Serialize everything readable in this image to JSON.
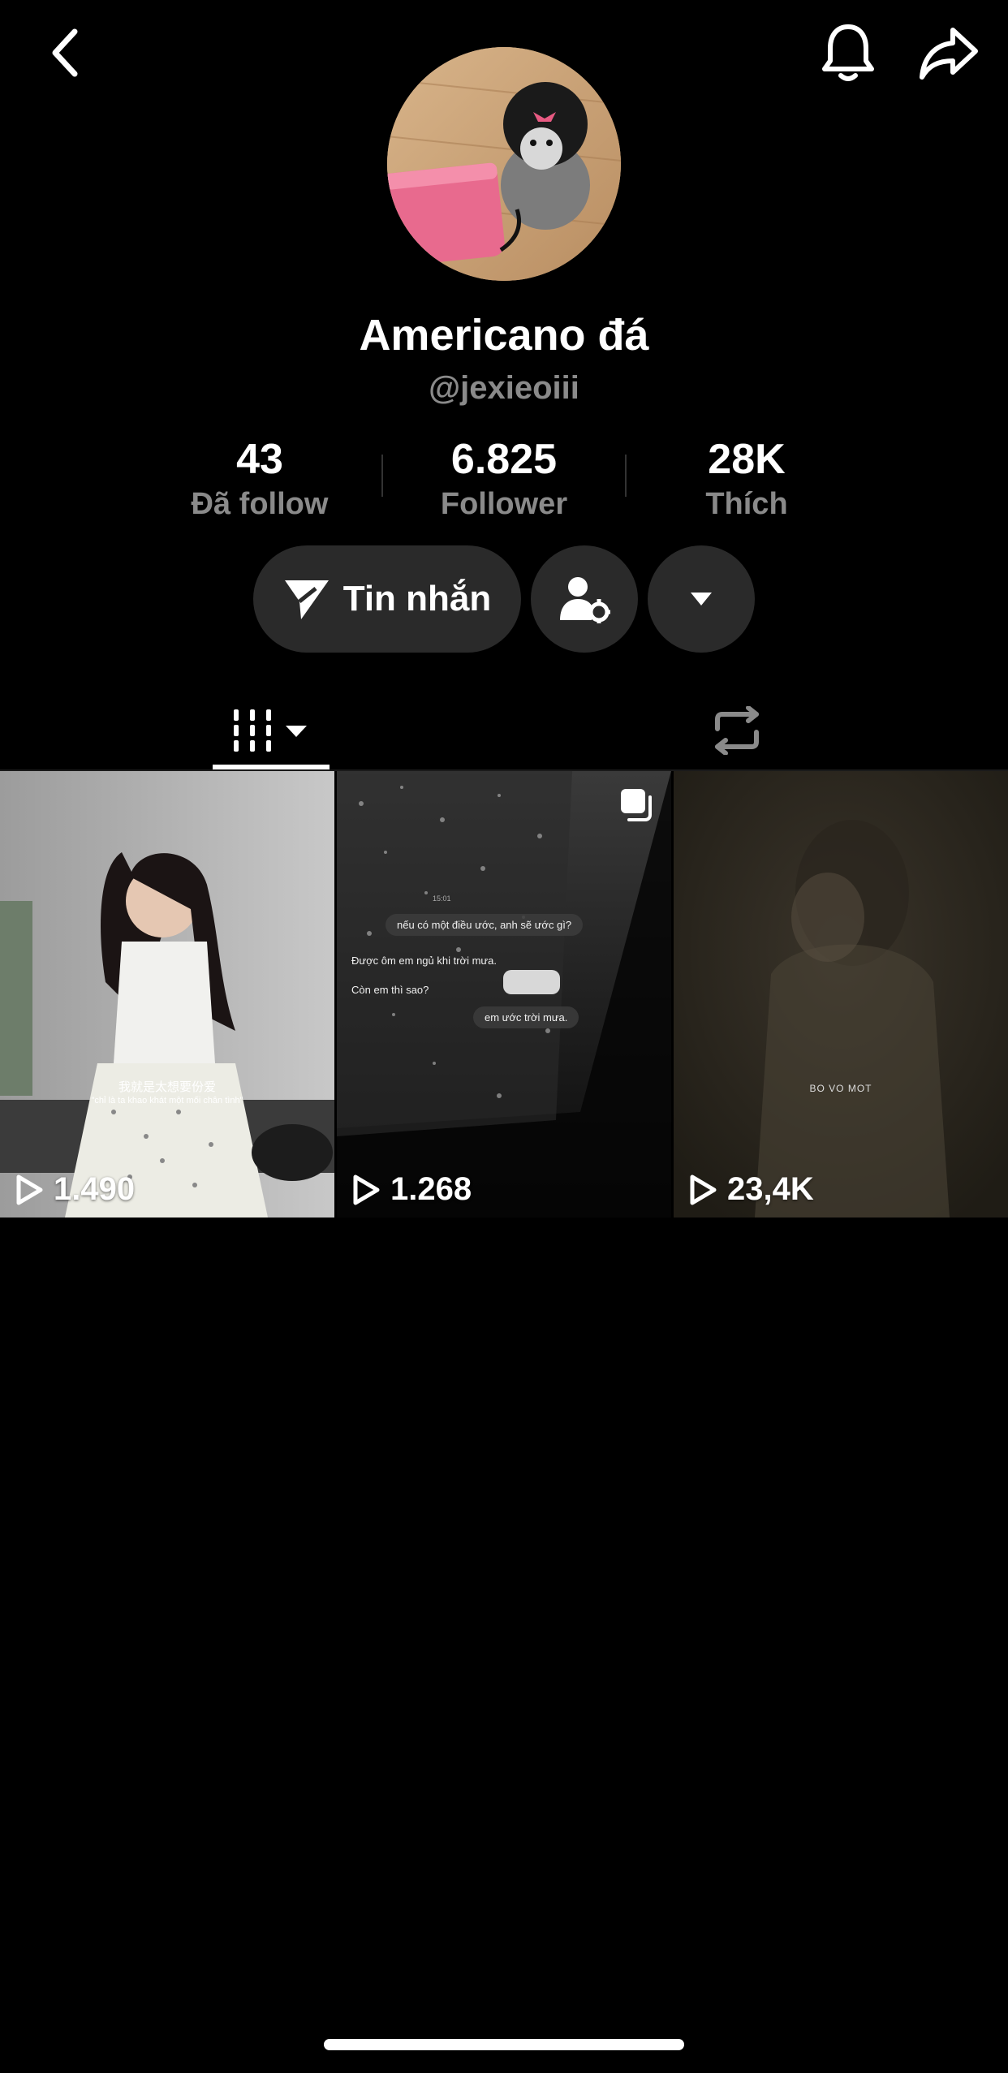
{
  "profile": {
    "display_name": "Americano đá",
    "username": "@jexieoiii"
  },
  "stats": {
    "following": {
      "value": "43",
      "label": "Đã follow"
    },
    "followers": {
      "value": "6.825",
      "label": "Follower"
    },
    "likes": {
      "value": "28K",
      "label": "Thích"
    }
  },
  "actions": {
    "message_label": "Tin nhắn"
  },
  "icons": {
    "back": "chevron-left-icon",
    "bell": "bell-icon",
    "share": "share-arrow-icon",
    "send": "paper-plane-icon",
    "friends": "person-settings-icon",
    "more": "caret-down-icon",
    "videos_tab": "grid-bars-icon",
    "reposts_tab": "repost-icon",
    "play": "play-icon",
    "multi": "multi-photo-icon"
  },
  "videos": [
    {
      "views": "1.490",
      "caption_cn": "我就是太想要份爱",
      "caption_vi": "\"chỉ là ta khao khát một mối chân tình\""
    },
    {
      "views": "1.268",
      "time": "15:01",
      "chat": [
        "nếu có một điều ước, anh sẽ ước gì?",
        "Được ôm em ngủ khi trời mưa.",
        "Còn em thì sao?",
        "em ước trời mưa."
      ]
    },
    {
      "views": "23,4K",
      "caption": "BO VO MOT"
    }
  ]
}
